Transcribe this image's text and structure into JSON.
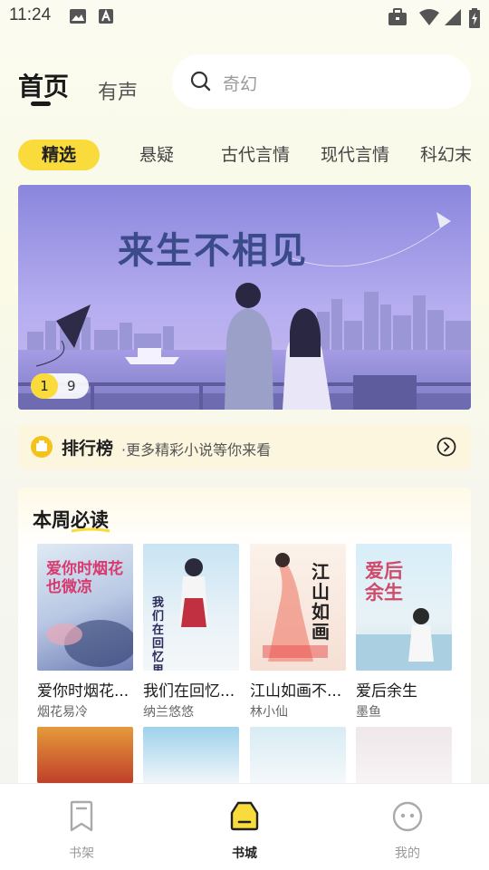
{
  "status_bar": {
    "time": "11:24"
  },
  "header": {
    "tabs": [
      {
        "label": "首页",
        "active": true
      },
      {
        "label": "有声",
        "active": false
      }
    ],
    "search": {
      "placeholder": "奇幻"
    }
  },
  "categories": [
    {
      "label": "精选",
      "active": true
    },
    {
      "label": "悬疑"
    },
    {
      "label": "古代言情"
    },
    {
      "label": "现代言情"
    },
    {
      "label": "科幻末"
    }
  ],
  "banner": {
    "title": "来生不相见",
    "page_current": "1",
    "page_total": "9"
  },
  "ranking": {
    "title": "排行榜",
    "subtitle": "·更多精彩小说等你来看"
  },
  "weekly": {
    "title": "本周必读",
    "books": [
      {
        "title": "爱你时烟花...",
        "author": "烟花易冷",
        "cover_text": "爱你时烟花也微凉"
      },
      {
        "title": "我们在回忆...",
        "author": "纳兰悠悠",
        "cover_text": "我们在回忆里相忘"
      },
      {
        "title": "江山如画不...",
        "author": "林小仙",
        "cover_text": "江山如画"
      },
      {
        "title": "爱后余生",
        "author": "墨鱼",
        "cover_text": "爱后余生"
      }
    ]
  },
  "bottom_nav": [
    {
      "label": "书架",
      "icon": "bookmark-icon",
      "active": false
    },
    {
      "label": "书城",
      "icon": "store-icon",
      "active": true
    },
    {
      "label": "我的",
      "icon": "face-icon",
      "active": false
    }
  ],
  "colors": {
    "accent": "#f9db3c",
    "rank_bg": "#fdf6df",
    "banner_sky": "#8f8de0"
  }
}
